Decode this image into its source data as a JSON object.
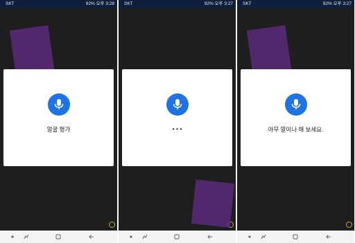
{
  "status_bar": {
    "carrier": "SKT",
    "battery": "92%",
    "times": [
      "오후 3:28",
      "오후 3:27",
      "오후 3:27"
    ]
  },
  "screens": [
    {
      "message": "얼굴 평가"
    },
    {
      "message": "• • •"
    },
    {
      "message": "아무 말이나 해 보세요."
    }
  ],
  "icons": {
    "mic": "microphone-icon",
    "nav_dot": "nav-dot-icon",
    "nav_recent": "recent-apps-icon",
    "nav_home": "home-icon",
    "nav_back": "back-icon"
  },
  "colors": {
    "mic_button": "#1e72e3",
    "status_bar": "#0d1f3c",
    "background": "#1e1e1e",
    "card": "#ffffff",
    "navbar": "#f3f3f3"
  }
}
